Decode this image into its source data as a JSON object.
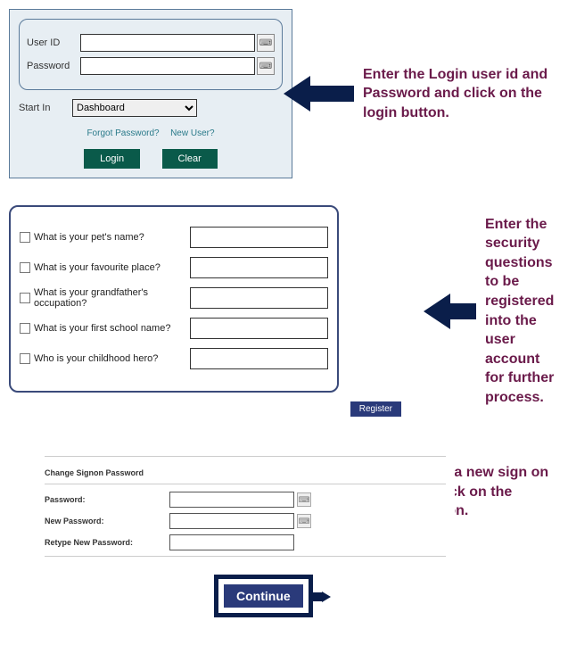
{
  "login": {
    "user_id_label": "User ID",
    "password_label": "Password",
    "start_in_label": "Start In",
    "start_in_value": "Dashboard",
    "forgot_link": "Forgot Password?",
    "new_user_link": "New User?",
    "login_btn": "Login",
    "clear_btn": "Clear"
  },
  "captions": {
    "login": "Enter the Login user id and Password and click on the login button.",
    "security": "Enter the security questions to be registered into the user account for further process.",
    "changepw": "After entering a new sign on password, Click on the continue button."
  },
  "security": {
    "questions": [
      "What is your pet's name?",
      "What is your favourite place?",
      "What is your grandfather's occupation?",
      "What is your first school name?",
      "Who is your childhood hero?"
    ],
    "register_btn": "Register"
  },
  "changepw": {
    "title": "Change Signon Password",
    "password_label": "Password:",
    "new_password_label": "New Password:",
    "retype_label": "Retype New Password:",
    "continue_btn": "Continue"
  }
}
